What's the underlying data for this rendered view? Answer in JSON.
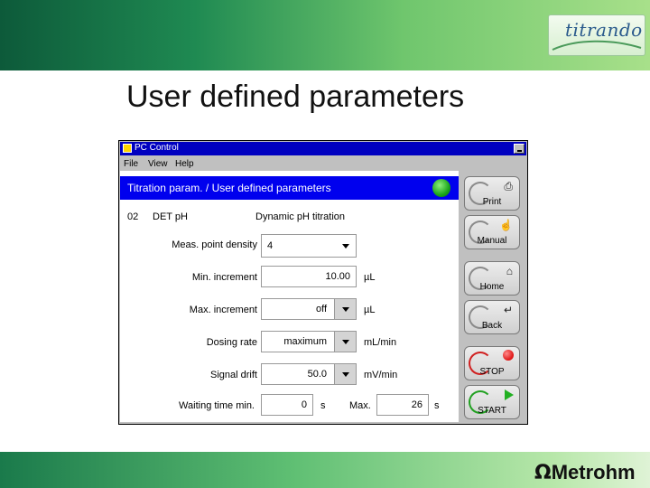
{
  "brand": {
    "logo_text": "titrando",
    "logo_mark": "®"
  },
  "slide": {
    "title": "User defined parameters"
  },
  "window": {
    "title": "PC Control",
    "menu": [
      "File",
      "View",
      "Help"
    ]
  },
  "header": {
    "text": "Titration param. / User defined parameters",
    "status_color": "#1aa51a"
  },
  "method": {
    "code": "02",
    "mode": "DET pH",
    "name": "Dynamic pH titration"
  },
  "fields": {
    "meas_point_density": {
      "label": "Meas. point density",
      "value": "4"
    },
    "min_increment": {
      "label": "Min. increment",
      "value": "10.00",
      "unit": "µL"
    },
    "max_increment": {
      "label": "Max. increment",
      "value": "off",
      "unit": "µL"
    },
    "dosing_rate": {
      "label": "Dosing rate",
      "value": "maximum",
      "unit": "mL/min"
    },
    "signal_drift": {
      "label": "Signal drift",
      "value": "50.0",
      "unit": "mV/min"
    },
    "waiting_time_min": {
      "label": "Waiting time min.",
      "value": "0",
      "unit": "s"
    },
    "waiting_time_max": {
      "label": "Max.",
      "value": "26",
      "unit": "s"
    }
  },
  "buttons": {
    "print": "Print",
    "manual": "Manual",
    "home": "Home",
    "back": "Back",
    "stop": "STOP",
    "start": "START"
  },
  "footer": {
    "company": "Metrohm",
    "logo_glyph": "Ω"
  },
  "colors": {
    "header_blue": "#0000ee",
    "titlebar_blue": "#0000c0",
    "stop_red": "#e01a1a",
    "start_green": "#22b022"
  }
}
